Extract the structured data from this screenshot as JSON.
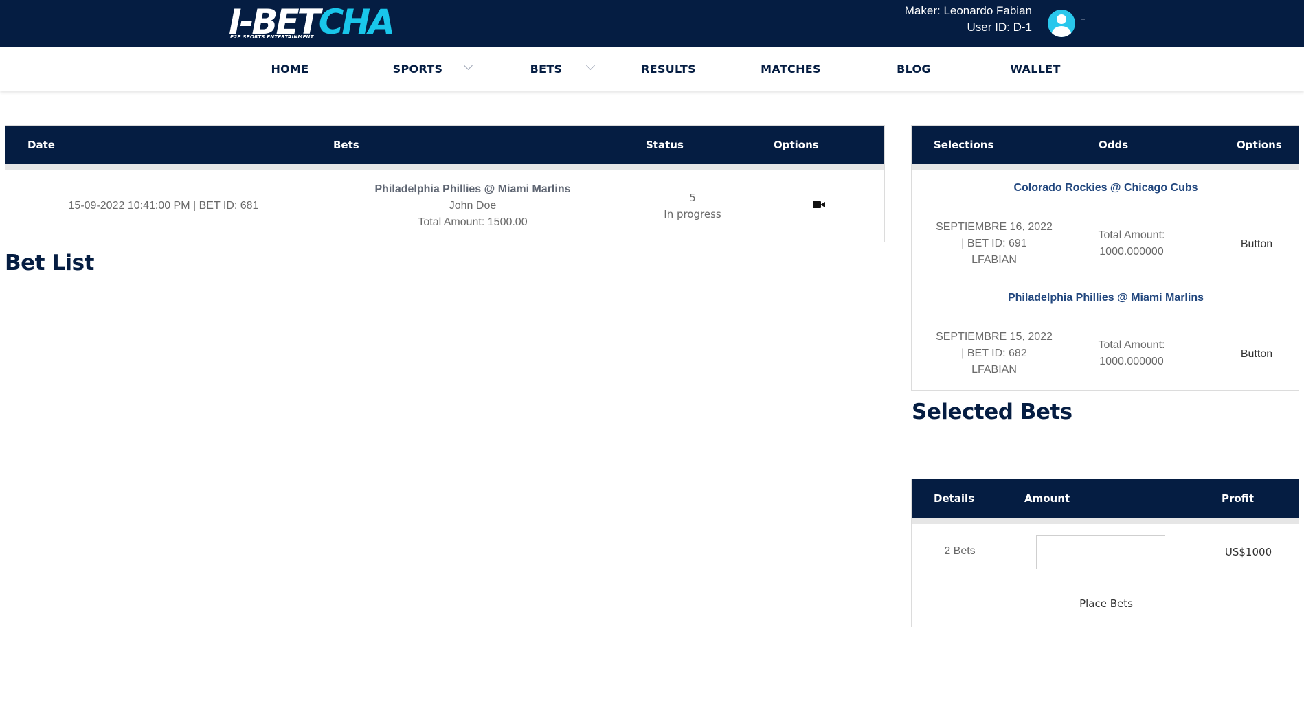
{
  "brand": {
    "logo_primary": "I-BET",
    "logo_accent": "CHA",
    "tagline": "P2P SPORTS ENTERTAINMENT",
    "colors": {
      "navy": "#051d42",
      "cyan": "#19c6ea"
    }
  },
  "user": {
    "maker_label": "Maker: Leonardo Fabian",
    "user_id_label": "User ID: D-1",
    "avatar_icon": "user-circle-icon"
  },
  "nav": {
    "home": "HOME",
    "sports": "SPORTS",
    "bets": "BETS",
    "results": "RESULTS",
    "matches": "MATCHES",
    "blog": "BLOG",
    "wallet": "WALLET"
  },
  "bet_list": {
    "title": "Bet List",
    "headers": {
      "date": "Date",
      "bets": "Bets",
      "status": "Status",
      "options": "Options"
    },
    "rows": [
      {
        "date": "15-09-2022 10:41:00 PM | BET ID: 681",
        "match": "Philadelphia Phillies @ Miami Marlins",
        "player": "John Doe",
        "total": "Total Amount: 1500.00",
        "status_code": "5",
        "status": "In progress",
        "option_icon": "video-camera-icon"
      }
    ]
  },
  "selections": {
    "title": "Selected Bets",
    "headers": {
      "selections": "Selections",
      "odds": "Odds",
      "options": "Options"
    },
    "items": [
      {
        "match": "Colorado Rockies @ Chicago Cubs",
        "date_line1": "SEPTIEMBRE 16, 2022",
        "date_line2": "| BET ID: 691",
        "user": "LFABIAN",
        "amount_label": "Total Amount:",
        "amount_value": "1000.000000",
        "button": "Button"
      },
      {
        "match": "Philadelphia Phillies @ Miami Marlins",
        "date_line1": "SEPTIEMBRE 15, 2022",
        "date_line2": "| BET ID: 682",
        "user": "LFABIAN",
        "amount_label": "Total Amount:",
        "amount_value": "1000.000000",
        "button": "Button"
      }
    ]
  },
  "summary": {
    "headers": {
      "details": "Details",
      "amount": "Amount",
      "profit": "Profit"
    },
    "details": "2 Bets",
    "amount_value": "",
    "amount_placeholder": "",
    "profit": "US$1000",
    "place_button": "Place Bets"
  }
}
